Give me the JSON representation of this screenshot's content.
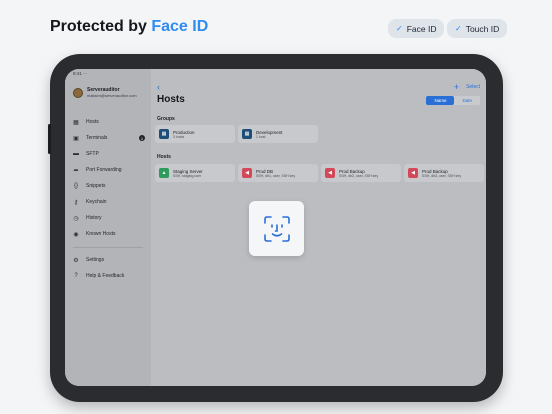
{
  "headline": {
    "prefix": "Protected by ",
    "accent": "Face ID"
  },
  "pills": [
    {
      "label": "Face ID"
    },
    {
      "label": "Touch ID"
    }
  ],
  "statusbar": {
    "text": "9:41 ···"
  },
  "account": {
    "name": "Serverauditor",
    "email": "maksim@serverauditor.com"
  },
  "sidebar": {
    "items": [
      {
        "label": "Hosts",
        "icon": "grid-icon"
      },
      {
        "label": "Terminals",
        "icon": "terminal-icon",
        "badge": "1"
      },
      {
        "label": "SFTP",
        "icon": "folder-icon"
      },
      {
        "label": "Port Forwarding",
        "icon": "forward-icon"
      },
      {
        "label": "Snippets",
        "icon": "braces-icon"
      },
      {
        "label": "Keychain",
        "icon": "key-icon"
      },
      {
        "label": "History",
        "icon": "clock-icon"
      },
      {
        "label": "Known Hosts",
        "icon": "globe-icon"
      }
    ],
    "footer": [
      {
        "label": "Settings",
        "icon": "gear-icon"
      },
      {
        "label": "Help & Feedback",
        "icon": "help-icon"
      }
    ]
  },
  "main": {
    "back": "‹",
    "title": "Hosts",
    "select_label": "Select",
    "plus": "+",
    "sort": {
      "options": [
        "Name",
        "Date"
      ],
      "selected": "Name"
    },
    "groups_label": "Groups",
    "groups": [
      {
        "name": "Production",
        "sub": "3 hosts",
        "color": "#1f4d7a"
      },
      {
        "name": "Development",
        "sub": "1 host",
        "color": "#1f4d7a"
      }
    ],
    "hosts_label": "Hosts",
    "hosts": [
      {
        "name": "Staging Server",
        "sub": "SSH, staging.user",
        "color": "#2e9a5c"
      },
      {
        "name": "Prod DB",
        "sub": "SSH, db1, user, SSH key",
        "color": "#d2495a"
      },
      {
        "name": "Prod Backup",
        "sub": "SSH, db2, user, SSH key",
        "color": "#d2495a"
      },
      {
        "name": "Prod Backup",
        "sub": "SSH, db3, user, SSH key",
        "color": "#d2495a"
      }
    ]
  },
  "colors": {
    "accent": "#2f8cf0",
    "link": "#2a6fd6"
  }
}
